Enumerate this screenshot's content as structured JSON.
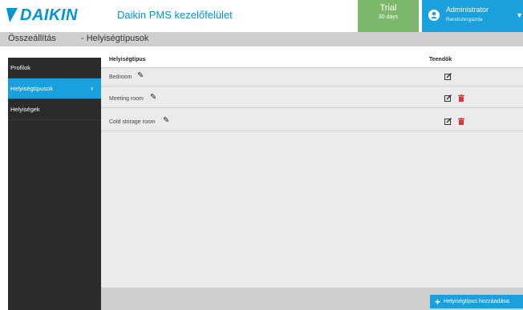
{
  "header": {
    "logo_text": "DAIKIN",
    "app_title": "Daikin PMS kezelőfelület",
    "trial_label": "Trial",
    "trial_days": "30 days",
    "user_name": "Administrator",
    "user_role": "Rendszergazda"
  },
  "breadcrumb": {
    "section": "Összeállítás",
    "page": "- Helyiségtípusok"
  },
  "sidebar": {
    "items": [
      {
        "label": "Profilok",
        "active": false
      },
      {
        "label": "Helyiségtípusok",
        "active": true
      },
      {
        "label": "Helyiségek",
        "active": false
      }
    ]
  },
  "table": {
    "col_name": "Helyiségtípus",
    "col_actions": "Teendők",
    "rows": [
      {
        "name": "Bedroom",
        "deletable": false
      },
      {
        "name": "Meeting room",
        "deletable": true
      },
      {
        "name": "Cold storage room",
        "deletable": true
      }
    ]
  },
  "actions": {
    "add_label": "Helyiségtípus hozzáadása"
  },
  "colors": {
    "brand": "#0096d6",
    "trial": "#7cb86a",
    "delete": "#d9373a"
  }
}
